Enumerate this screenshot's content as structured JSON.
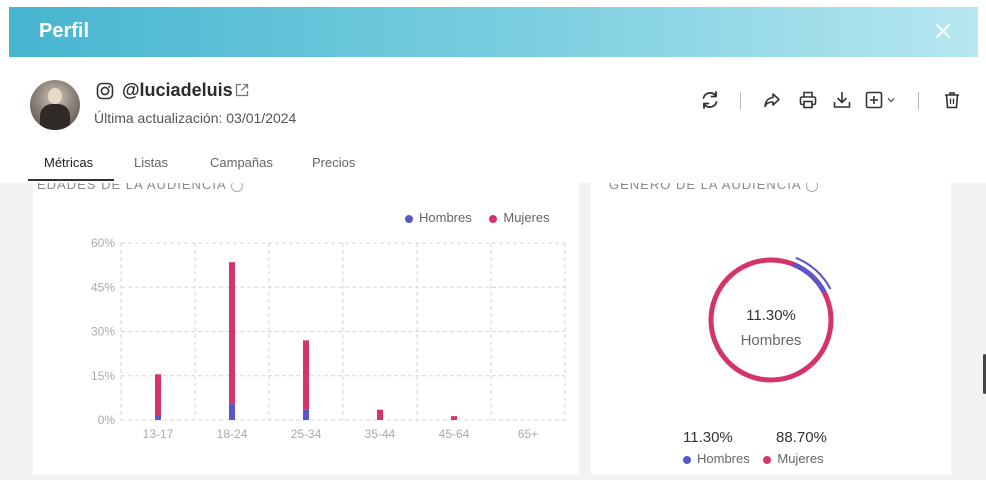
{
  "header": {
    "title": "Perfil",
    "close_icon": "close-icon"
  },
  "profile": {
    "username": "@luciadeluis",
    "updated": "Última actualización: 03/01/2024",
    "icons": [
      "instagram-icon",
      "external-link-icon"
    ]
  },
  "toolbar": {
    "icons": [
      "refresh-icon",
      "share-icon",
      "print-icon",
      "download-icon",
      "add-to-list-icon",
      "chevron-down-icon",
      "trash-icon"
    ]
  },
  "tabs": [
    {
      "label": "Métricas",
      "active": true
    },
    {
      "label": "Listas",
      "active": false
    },
    {
      "label": "Campañas",
      "active": false
    },
    {
      "label": "Precios",
      "active": false
    }
  ],
  "colors": {
    "hombres": "#5a55c9",
    "mujeres": "#d6336c",
    "header_start": "#46b5cf",
    "header_end": "#b7e7f0"
  },
  "ages_card": {
    "title": "EDADES DE LA AUDIENCIA",
    "legend": {
      "hombres": "Hombres",
      "mujeres": "Mujeres"
    },
    "yticks": [
      "0%",
      "15%",
      "30%",
      "45%",
      "60%"
    ]
  },
  "gender_card": {
    "title": "GÉNERO DE LA AUDIENCIA",
    "center_value": "11.30%",
    "center_label": "Hombres",
    "hombres_pct": "11.30%",
    "mujeres_pct": "88.70%",
    "legend": {
      "hombres": "Hombres",
      "mujeres": "Mujeres"
    }
  },
  "chart_data": [
    {
      "type": "bar",
      "stacked": true,
      "categories": [
        "13-17",
        "18-24",
        "25-34",
        "35-44",
        "45-64",
        "65+"
      ],
      "series": [
        {
          "name": "Hombres",
          "values": [
            1.5,
            5.5,
            3.5,
            0.3,
            0.2,
            0
          ]
        },
        {
          "name": "Mujeres",
          "values": [
            14,
            48,
            23.5,
            3.2,
            1.1,
            0
          ]
        }
      ],
      "ylim": [
        0,
        60
      ],
      "yunit": "%",
      "legend": "top-right",
      "grid": true
    },
    {
      "type": "pie",
      "donut": true,
      "labels": [
        "Hombres",
        "Mujeres"
      ],
      "values": [
        11.3,
        88.7
      ]
    }
  ]
}
